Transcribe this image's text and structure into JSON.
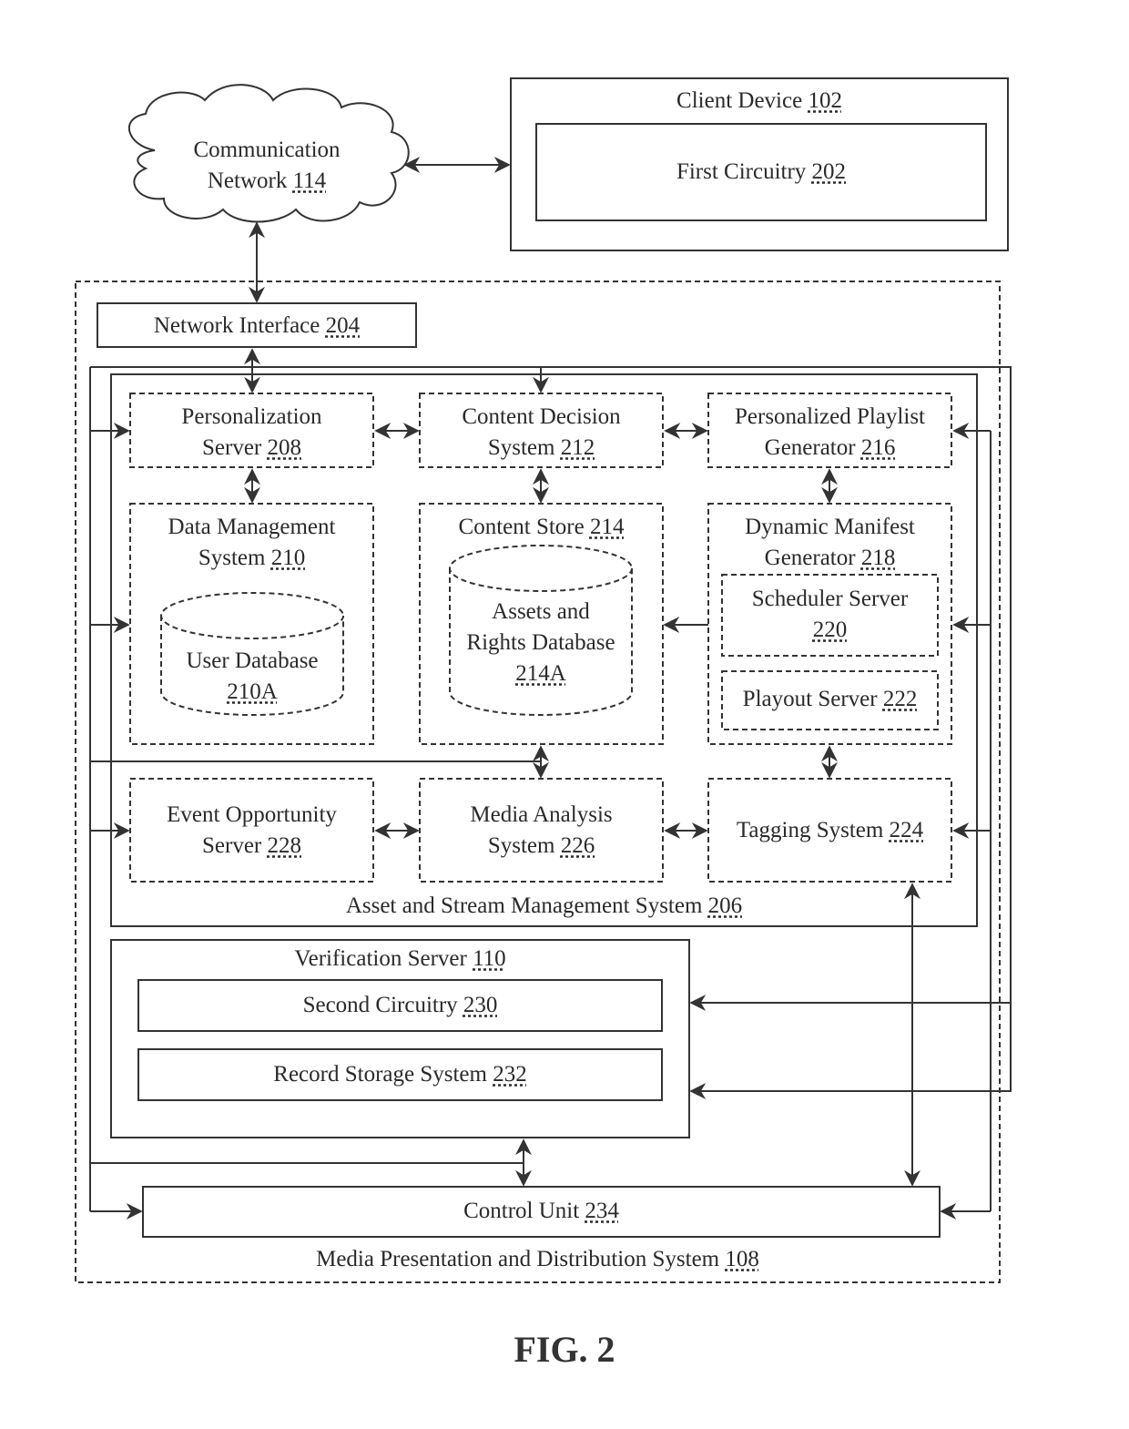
{
  "figure_label": "FIG. 2",
  "nodes": {
    "client_device": {
      "name": "Client Device",
      "ref": "102"
    },
    "first_circuitry": {
      "name": "First Circuitry",
      "ref": "202"
    },
    "comm_network": {
      "line1": "Communication",
      "name": "Network",
      "ref": "114"
    },
    "network_interface": {
      "name": "Network Interface",
      "ref": "204"
    },
    "personalization_server": {
      "line1": "Personalization",
      "name": "Server",
      "ref": "208"
    },
    "content_decision": {
      "line1": "Content Decision",
      "name": "System",
      "ref": "212"
    },
    "playlist_generator": {
      "line1": "Personalized Playlist",
      "name": "Generator",
      "ref": "216"
    },
    "data_management": {
      "line1": "Data Management",
      "name": "System ",
      "ref": "210"
    },
    "user_database": {
      "line1": "User Database",
      "ref": "210A"
    },
    "content_store": {
      "name": "Content Store",
      "ref": "214"
    },
    "assets_rights_db": {
      "line1": "Assets and",
      "line2": "Rights Database",
      "ref": "214A"
    },
    "manifest_generator": {
      "line1": "Dynamic Manifest",
      "name": "Generator",
      "ref": "218"
    },
    "scheduler_server": {
      "line1": "Scheduler Server",
      "ref": "220"
    },
    "playout_server": {
      "name": "Playout Server",
      "ref": "222"
    },
    "event_opportunity": {
      "line1": "Event Opportunity",
      "name": "Server",
      "ref": "228"
    },
    "media_analysis": {
      "line1": "Media Analysis",
      "name": "System",
      "ref": "226"
    },
    "tagging_system": {
      "name": "Tagging System",
      "ref": "224"
    },
    "asset_stream_mgmt": {
      "name": "Asset and Stream Management System",
      "ref": "206"
    },
    "verification_server": {
      "name": "Verification Server",
      "ref": "110"
    },
    "second_circuitry": {
      "name": "Second Circuitry",
      "ref": "230"
    },
    "record_storage": {
      "name": "Record Storage System",
      "ref": "232"
    },
    "control_unit": {
      "name": "Control Unit",
      "ref": "234"
    },
    "media_presentation": {
      "name": "Media Presentation and Distribution System",
      "ref": "108"
    }
  },
  "colors": {
    "stroke": "#333333",
    "text": "#2a2a2a",
    "background": "#ffffff"
  }
}
